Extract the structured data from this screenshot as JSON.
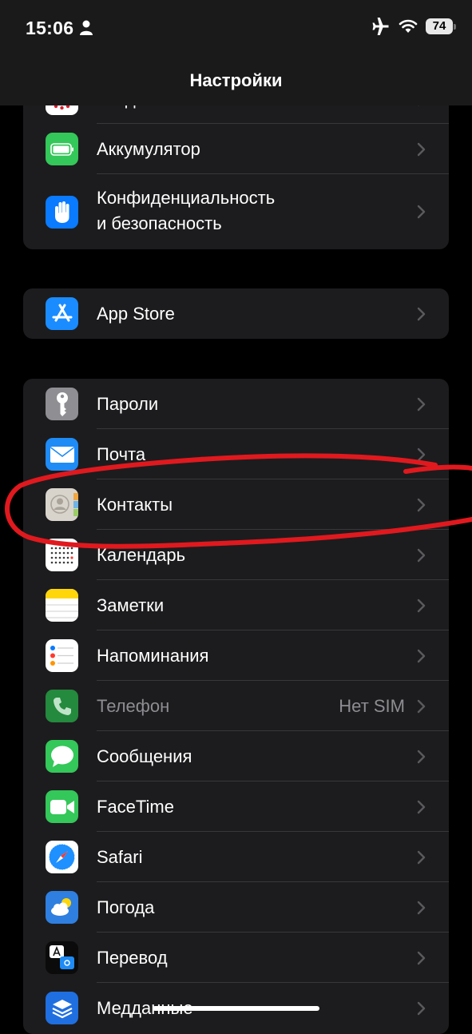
{
  "status_bar": {
    "time": "15:06",
    "battery_level": "74"
  },
  "nav": {
    "title": "Настройки"
  },
  "group_top": {
    "items": [
      {
        "label": "Уведомления о контакте"
      },
      {
        "label": "Аккумулятор"
      },
      {
        "label_line1": "Конфиденциальность",
        "label_line2": "и безопасность"
      }
    ]
  },
  "group_appstore": {
    "items": [
      {
        "label": "App Store"
      }
    ]
  },
  "group_apps": {
    "items": [
      {
        "label": "Пароли"
      },
      {
        "label": "Почта"
      },
      {
        "label": "Контакты"
      },
      {
        "label": "Календарь"
      },
      {
        "label": "Заметки"
      },
      {
        "label": "Напоминания"
      },
      {
        "label": "Телефон",
        "value": "Нет SIM"
      },
      {
        "label": "Сообщения"
      },
      {
        "label": "FaceTime"
      },
      {
        "label": "Safari"
      },
      {
        "label": "Погода"
      },
      {
        "label": "Перевод"
      },
      {
        "label": "Медданные"
      }
    ]
  },
  "colors": {
    "background": "#000000",
    "cell": "#1c1c1e",
    "separator": "#38383a",
    "secondary_text": "#8d8d92",
    "annotation": "#e0191e"
  },
  "icons": {
    "notifications": "exposure-dots-icon",
    "battery": "battery-icon",
    "privacy": "hand-icon",
    "app_store": "app-store-icon",
    "passwords": "key-icon",
    "mail": "envelope-icon",
    "contacts": "contacts-icon",
    "calendar": "calendar-icon",
    "notes": "notes-icon",
    "reminders": "reminders-icon",
    "phone": "phone-icon",
    "messages": "speech-bubble-icon",
    "facetime": "video-camera-icon",
    "safari": "compass-icon",
    "weather": "weather-icon",
    "translate": "translate-icon",
    "health": "health-records-icon"
  }
}
